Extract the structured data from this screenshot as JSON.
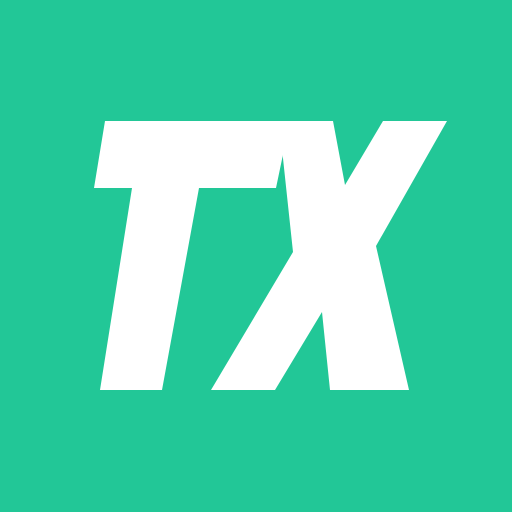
{
  "logo": {
    "text": "TX",
    "background_color": "#22C797",
    "foreground_color": "#FFFFFF"
  }
}
